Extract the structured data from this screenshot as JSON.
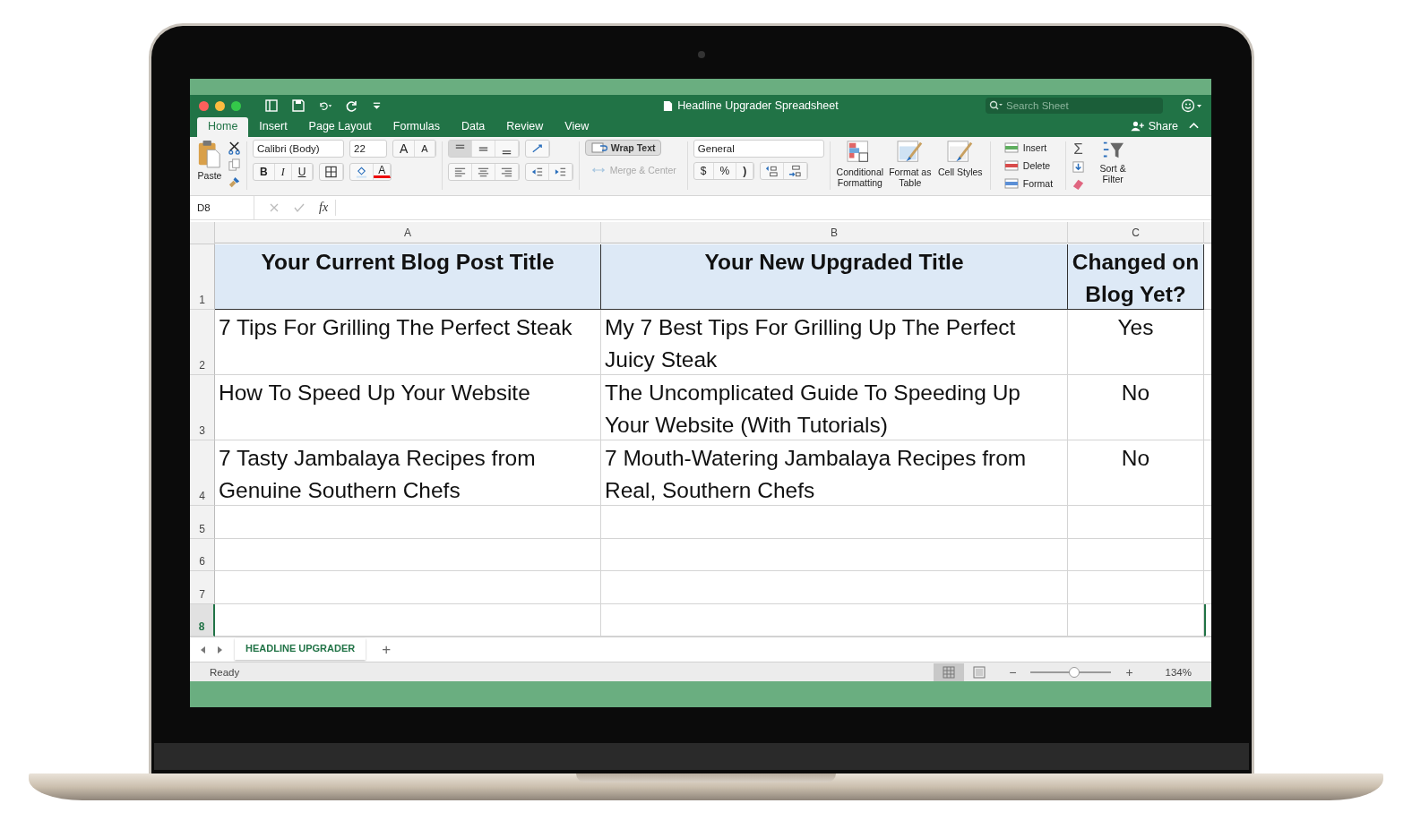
{
  "window": {
    "title": "Headline Upgrader Spreadsheet"
  },
  "search": {
    "placeholder": "Search Sheet"
  },
  "share": "Share",
  "tabs": [
    {
      "label": "Home",
      "selected": true
    },
    {
      "label": "Insert",
      "selected": false
    },
    {
      "label": "Page Layout",
      "selected": false
    },
    {
      "label": "Formulas",
      "selected": false
    },
    {
      "label": "Data",
      "selected": false
    },
    {
      "label": "Review",
      "selected": false
    },
    {
      "label": "View",
      "selected": false
    }
  ],
  "ribbon": {
    "paste": "Paste",
    "font_name": "Calibri (Body)",
    "font_size": "22",
    "grow_shrink": [
      "A",
      "A"
    ],
    "styles": [
      "B",
      "I",
      "U"
    ],
    "font_color": "A",
    "wrap_text": "Wrap Text",
    "merge": {
      "label": "Merge & Center",
      "disabled": true
    },
    "number_format": "General",
    "currency": "$",
    "percent": "%",
    "comma": ")",
    "large_buttons": [
      "Conditional Formatting",
      "Format as Table",
      "Cell Styles"
    ],
    "cells_buttons": [
      "Insert",
      "Delete",
      "Format"
    ],
    "autosum": "Σ",
    "sort": "Sort & Filter"
  },
  "formula_bar": {
    "name_box": "D8",
    "fx": "fx"
  },
  "columns": [
    "A",
    "B",
    "C"
  ],
  "rows": [
    {
      "number": "1",
      "kind": "header",
      "selected": false,
      "cells": [
        "Your Current Blog Post Title",
        "Your New Upgraded Title",
        "Changed on Blog Yet?"
      ]
    },
    {
      "number": "2",
      "kind": "data",
      "selected": false,
      "cells": [
        "7 Tips For Grilling The Perfect Steak",
        "My 7 Best Tips For Grilling Up The Perfect Juicy Steak",
        "Yes"
      ]
    },
    {
      "number": "3",
      "kind": "data",
      "selected": false,
      "cells": [
        "How To Speed Up Your Website",
        "The Uncomplicated Guide To Speeding Up Your Website (With Tutorials)",
        "No"
      ]
    },
    {
      "number": "4",
      "kind": "data",
      "selected": false,
      "cells": [
        "7 Tasty Jambalaya Recipes from Genuine Southern Chefs",
        "7 Mouth-Watering Jambalaya Recipes from Real, Southern Chefs",
        "No"
      ]
    },
    {
      "number": "5",
      "kind": "empty",
      "selected": false,
      "cells": []
    },
    {
      "number": "6",
      "kind": "empty",
      "selected": false,
      "cells": []
    },
    {
      "number": "7",
      "kind": "empty",
      "selected": false,
      "cells": []
    },
    {
      "number": "8",
      "kind": "empty",
      "selected": true,
      "cells": []
    }
  ],
  "sheet_tabs": [
    {
      "label": "HEADLINE UPGRADER",
      "selected": true
    }
  ],
  "add_sheet": "+",
  "status_bar": {
    "status": "Ready",
    "zoom_out": "−",
    "zoom_in": "+",
    "zoom": {
      "level": 0.54
    },
    "zoom_reading": "134%"
  }
}
